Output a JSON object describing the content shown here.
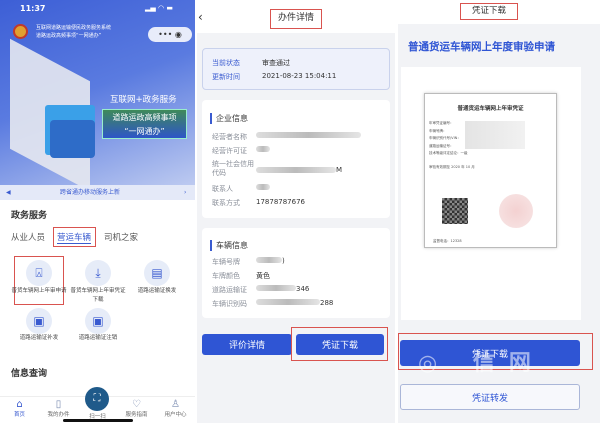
{
  "panel1": {
    "status_time": "11:37",
    "status_icons": "signal wifi battery",
    "app_title_line1": "互联网道路运输便民政务服务系统",
    "app_title_line2": "道路运政高频事项“一网通办”",
    "banner_line1": "互联网+政务服务",
    "banner_line2": "道路运政高频事项",
    "banner_line3": "“一网通办”",
    "notice": "跨省通办移动服务上新",
    "section_title": "政务服务",
    "tabs": [
      {
        "label": "从业人员"
      },
      {
        "label": "营运车辆"
      },
      {
        "label": "司机之家"
      }
    ],
    "services": [
      {
        "label": "普货车辆网上年审申请"
      },
      {
        "label": "普货车辆网上年审凭证下载"
      },
      {
        "label": "道路运输证换发"
      },
      {
        "label": "道路运输证补发"
      },
      {
        "label": "道路运输证注销"
      }
    ],
    "info_title": "信息查询",
    "nav": [
      {
        "label": "首页"
      },
      {
        "label": "我的办件"
      },
      {
        "label": "扫一扫"
      },
      {
        "label": "服务指南"
      },
      {
        "label": "用户中心"
      }
    ]
  },
  "panel2": {
    "title": "办件详情",
    "status_label": "当前状态",
    "status_value": "审查通过",
    "update_label": "更新时间",
    "update_value": "2021-08-23 15:04:11",
    "enterprise_title": "企业信息",
    "enterprise_rows": [
      {
        "label": "经营者名称",
        "value": ""
      },
      {
        "label": "经营许可证",
        "value": ""
      },
      {
        "label": "统一社会信用代码",
        "value": "M"
      },
      {
        "label": "联系人",
        "value": ""
      },
      {
        "label": "联系方式",
        "value": "17878787676"
      }
    ],
    "vehicle_title": "车辆信息",
    "vehicle_rows": [
      {
        "label": "车辆号牌",
        "value": ")"
      },
      {
        "label": "车牌颜色",
        "value": "黄色"
      },
      {
        "label": "道路运输证",
        "value": "346"
      },
      {
        "label": "车辆识别码",
        "value": "288"
      }
    ],
    "btn_evaluate": "评价详情",
    "btn_download": "凭证下载"
  },
  "panel3": {
    "title": "凭证下载",
    "heading": "普通货运车辆网上年度审验申请",
    "cert_title": "普通货运车辆网上年审凭证",
    "cert_lines": [
      "年审凭证编号：",
      "车辆号牌：",
      "车辆识别代号/VIN：",
      "道路运输证号：",
      "技术等级评定结论：一级"
    ],
    "cert_valid": "审验有效期至  2020 年 10 月",
    "cert_phone": "监督电话：12328",
    "btn_download": "凭证下载",
    "btn_forward": "凭证转发",
    "watermark": "信网"
  },
  "colors": {
    "primary": "#2f55d4",
    "highlight": "#d9534f"
  }
}
